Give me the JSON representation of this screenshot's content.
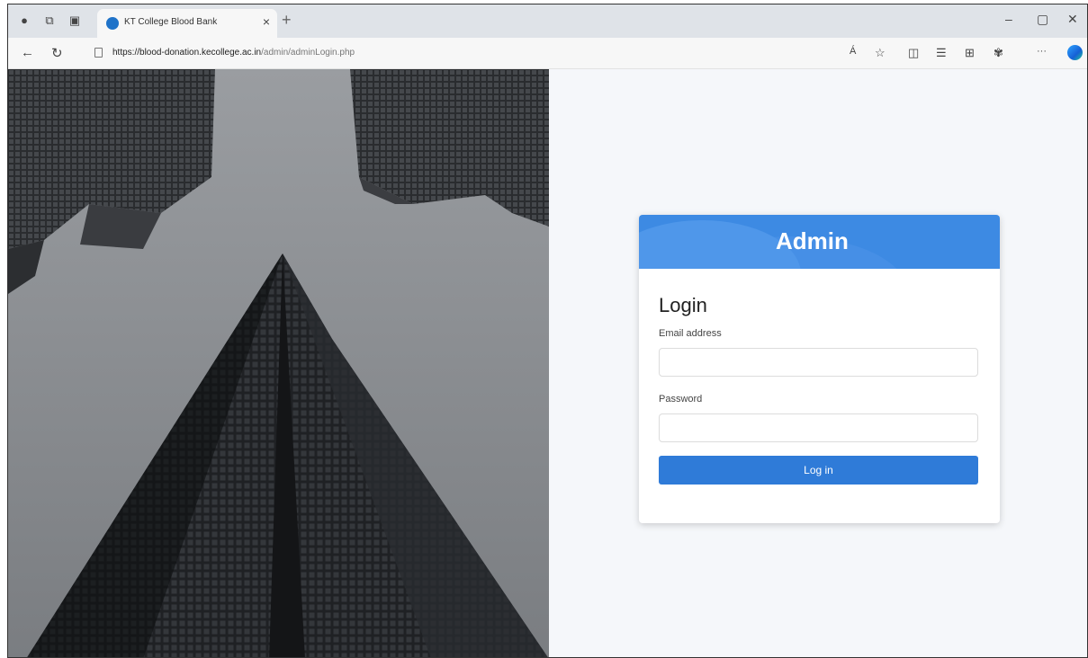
{
  "browser": {
    "tab_title": "KT College Blood Bank",
    "tab_close": "×",
    "new_tab": "+",
    "url_main": "https://blood-donation.kecollege.ac.in",
    "url_path": "/admin/adminLogin.php",
    "read_aloud": "Á",
    "more": "···",
    "icons": [
      "profile-icon",
      "workspaces-icon",
      "tab-actions-icon",
      "back-icon",
      "refresh-icon",
      "site-info-icon",
      "read-aloud-icon",
      "favorite-icon",
      "split-screen-icon",
      "favorites-icon",
      "collections-icon",
      "extensions-icon",
      "more-icon",
      "copilot-icon"
    ]
  },
  "card": {
    "header_title": "Admin",
    "heading": "Login",
    "email_label": "Email address",
    "email_value": "",
    "password_label": "Password",
    "password_value": "",
    "submit_label": "Log in"
  },
  "colors": {
    "header_blue": "#3d8ae3",
    "button_blue": "#2f7bd8",
    "page_bg": "#f5f7fa"
  }
}
